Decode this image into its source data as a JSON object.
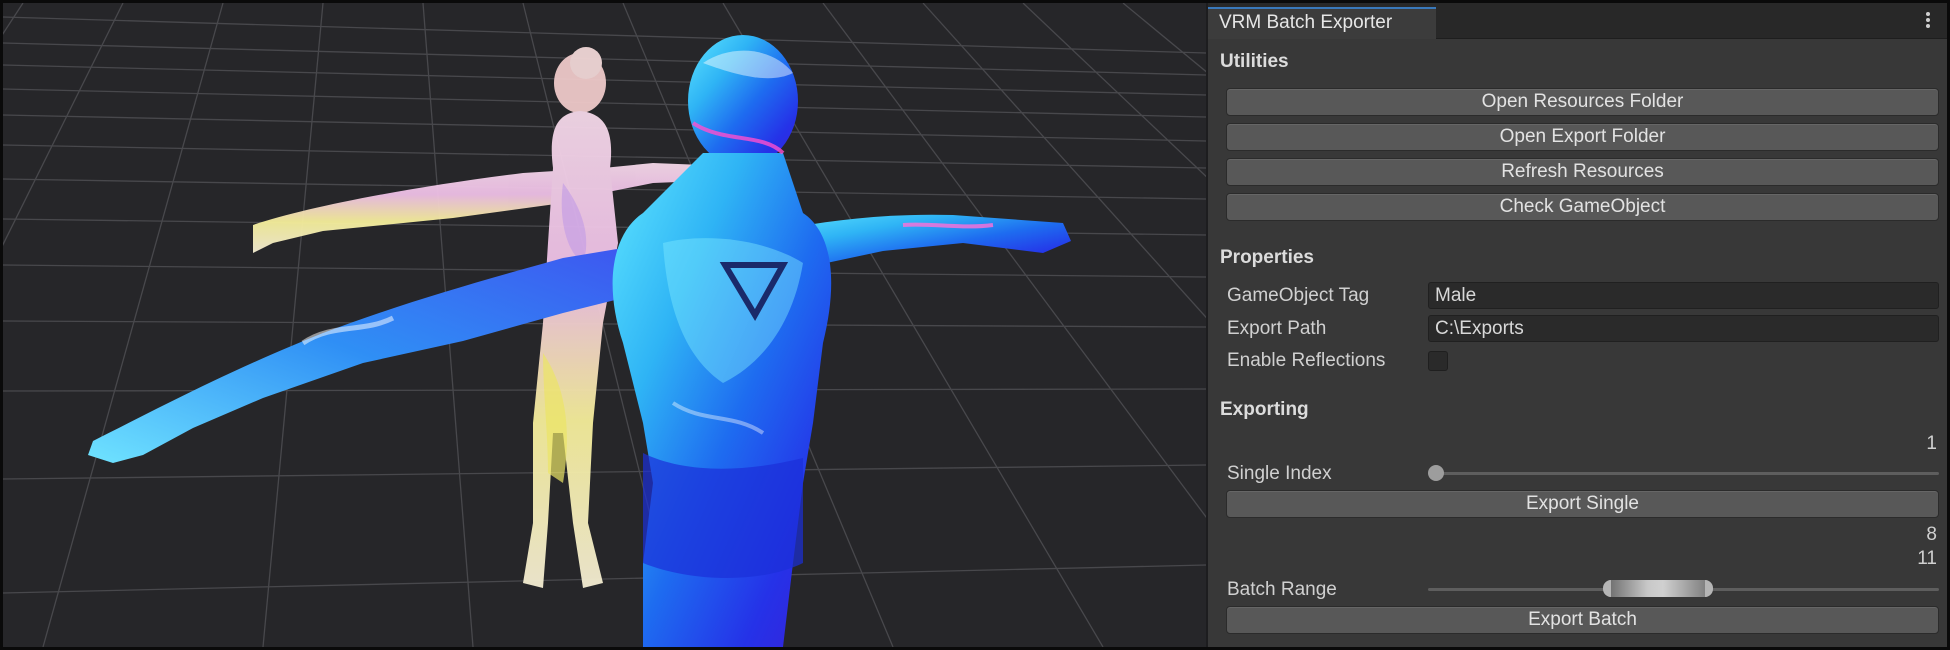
{
  "panel": {
    "tab_title": "VRM Batch Exporter",
    "menu_icon": "kebab-menu-icon",
    "utilities": {
      "heading": "Utilities",
      "buttons": [
        "Open Resources Folder",
        "Open Export Folder",
        "Refresh Resources",
        "Check GameObject"
      ]
    },
    "properties": {
      "heading": "Properties",
      "gameobject_tag_label": "GameObject Tag",
      "gameobject_tag_value": "Male",
      "export_path_label": "Export Path",
      "export_path_value": "C:\\Exports",
      "enable_reflections_label": "Enable Reflections",
      "enable_reflections_checked": false
    },
    "exporting": {
      "heading": "Exporting",
      "single_index_value": "1",
      "single_index_label": "Single Index",
      "single_index_fraction": 0,
      "export_single_button": "Export Single",
      "batch_range_min": "8",
      "batch_range_max": "11",
      "batch_range_label": "Batch Range",
      "batch_range_min_fraction": 0.35,
      "batch_range_max_fraction": 0.55,
      "export_batch_button": "Export Batch"
    }
  },
  "scene": {
    "background": "#262629",
    "grid_color": "#4a4a4e",
    "figures": [
      "female-t-pose-model",
      "male-t-pose-model"
    ]
  }
}
